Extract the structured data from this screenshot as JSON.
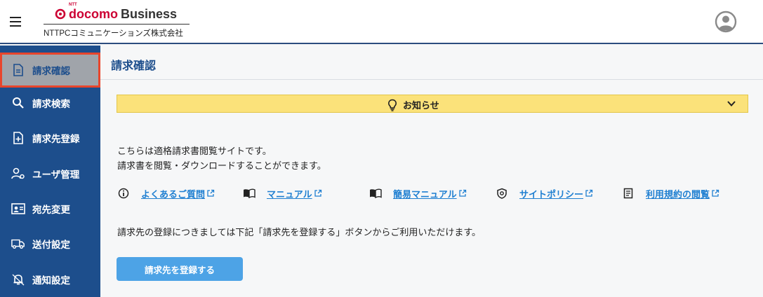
{
  "header": {
    "logo_brand": "docomo",
    "logo_business": "Business",
    "logo_ntt": "NTT",
    "company": "NTTPCコミュニケーションズ株式会社",
    "brand_color": "#cc0033"
  },
  "sidebar": {
    "items": [
      {
        "label": "請求確認",
        "icon": "document-icon",
        "active": true
      },
      {
        "label": "請求検索",
        "icon": "search-icon"
      },
      {
        "label": "請求先登録",
        "icon": "file-add-icon"
      },
      {
        "label": "ユーザ管理",
        "icon": "users-manage-icon"
      },
      {
        "label": "宛先変更",
        "icon": "contact-card-icon"
      },
      {
        "label": "送付設定",
        "icon": "truck-icon"
      },
      {
        "label": "通知設定",
        "icon": "bell-icon"
      }
    ],
    "bg_color": "#1d4e8c",
    "active_border": "#e8452c"
  },
  "main": {
    "title": "請求確認",
    "notice": {
      "label": "お知らせ",
      "icon": "lightbulb-icon",
      "bg_color": "#fbe27a"
    },
    "intro_line1": "こちらは適格請求書閲覧サイトです。",
    "intro_line2": "請求書を閲覧・ダウンロードすることができます。",
    "links": [
      {
        "label": "よくあるご質問",
        "icon": "info-icon"
      },
      {
        "label": "マニュアル",
        "icon": "book-icon"
      },
      {
        "label": "簡易マニュアル",
        "icon": "book-icon"
      },
      {
        "label": "サイトポリシー",
        "icon": "policy-icon"
      },
      {
        "label": "利用規約の閲覧",
        "icon": "terms-icon"
      }
    ],
    "link_color": "#1f7fd1",
    "register_note": "請求先の登録につきましては下記「請求先を登録する」ボタンからご利用いただけます。",
    "register_button": "請求先を登録する"
  }
}
